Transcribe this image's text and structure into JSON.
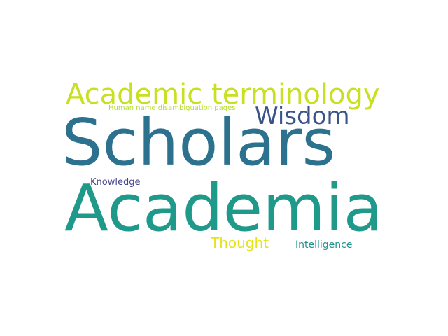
{
  "words": [
    {
      "text": "Scholars",
      "color": "#2c728e"
    },
    {
      "text": "Academia",
      "color": "#1f9a8a"
    },
    {
      "text": "Academic terminology",
      "color": "#c8e020"
    },
    {
      "text": "Wisdom",
      "color": "#3b528b"
    },
    {
      "text": "Human name disambiguation pages",
      "color": "#b5de2b"
    },
    {
      "text": "Knowledge",
      "color": "#46478a"
    },
    {
      "text": "Thought",
      "color": "#e5e419"
    },
    {
      "text": "Intelligence",
      "color": "#22908c"
    }
  ]
}
